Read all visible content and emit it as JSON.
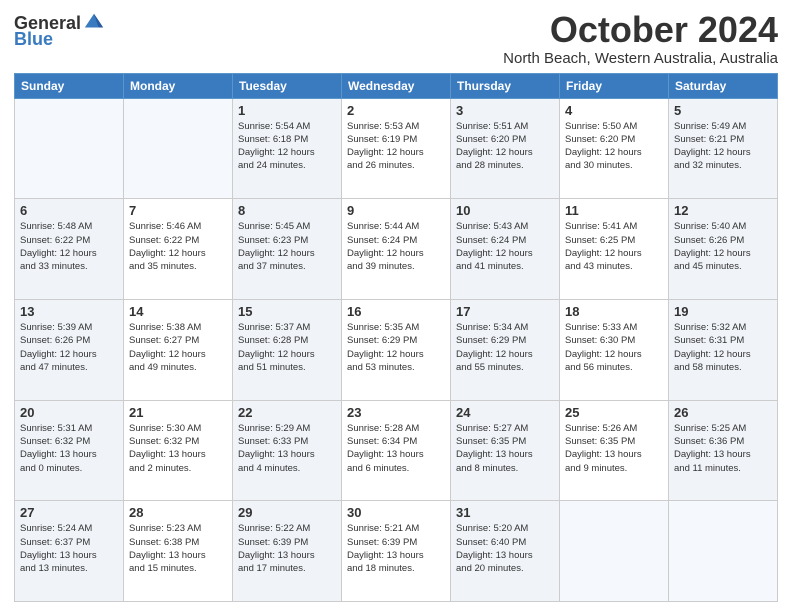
{
  "header": {
    "logo_general": "General",
    "logo_blue": "Blue",
    "month": "October 2024",
    "location": "North Beach, Western Australia, Australia"
  },
  "weekdays": [
    "Sunday",
    "Monday",
    "Tuesday",
    "Wednesday",
    "Thursday",
    "Friday",
    "Saturday"
  ],
  "rows": [
    [
      {
        "day": "",
        "content": ""
      },
      {
        "day": "",
        "content": ""
      },
      {
        "day": "1",
        "content": "Sunrise: 5:54 AM\nSunset: 6:18 PM\nDaylight: 12 hours\nand 24 minutes."
      },
      {
        "day": "2",
        "content": "Sunrise: 5:53 AM\nSunset: 6:19 PM\nDaylight: 12 hours\nand 26 minutes."
      },
      {
        "day": "3",
        "content": "Sunrise: 5:51 AM\nSunset: 6:20 PM\nDaylight: 12 hours\nand 28 minutes."
      },
      {
        "day": "4",
        "content": "Sunrise: 5:50 AM\nSunset: 6:20 PM\nDaylight: 12 hours\nand 30 minutes."
      },
      {
        "day": "5",
        "content": "Sunrise: 5:49 AM\nSunset: 6:21 PM\nDaylight: 12 hours\nand 32 minutes."
      }
    ],
    [
      {
        "day": "6",
        "content": "Sunrise: 5:48 AM\nSunset: 6:22 PM\nDaylight: 12 hours\nand 33 minutes."
      },
      {
        "day": "7",
        "content": "Sunrise: 5:46 AM\nSunset: 6:22 PM\nDaylight: 12 hours\nand 35 minutes."
      },
      {
        "day": "8",
        "content": "Sunrise: 5:45 AM\nSunset: 6:23 PM\nDaylight: 12 hours\nand 37 minutes."
      },
      {
        "day": "9",
        "content": "Sunrise: 5:44 AM\nSunset: 6:24 PM\nDaylight: 12 hours\nand 39 minutes."
      },
      {
        "day": "10",
        "content": "Sunrise: 5:43 AM\nSunset: 6:24 PM\nDaylight: 12 hours\nand 41 minutes."
      },
      {
        "day": "11",
        "content": "Sunrise: 5:41 AM\nSunset: 6:25 PM\nDaylight: 12 hours\nand 43 minutes."
      },
      {
        "day": "12",
        "content": "Sunrise: 5:40 AM\nSunset: 6:26 PM\nDaylight: 12 hours\nand 45 minutes."
      }
    ],
    [
      {
        "day": "13",
        "content": "Sunrise: 5:39 AM\nSunset: 6:26 PM\nDaylight: 12 hours\nand 47 minutes."
      },
      {
        "day": "14",
        "content": "Sunrise: 5:38 AM\nSunset: 6:27 PM\nDaylight: 12 hours\nand 49 minutes."
      },
      {
        "day": "15",
        "content": "Sunrise: 5:37 AM\nSunset: 6:28 PM\nDaylight: 12 hours\nand 51 minutes."
      },
      {
        "day": "16",
        "content": "Sunrise: 5:35 AM\nSunset: 6:29 PM\nDaylight: 12 hours\nand 53 minutes."
      },
      {
        "day": "17",
        "content": "Sunrise: 5:34 AM\nSunset: 6:29 PM\nDaylight: 12 hours\nand 55 minutes."
      },
      {
        "day": "18",
        "content": "Sunrise: 5:33 AM\nSunset: 6:30 PM\nDaylight: 12 hours\nand 56 minutes."
      },
      {
        "day": "19",
        "content": "Sunrise: 5:32 AM\nSunset: 6:31 PM\nDaylight: 12 hours\nand 58 minutes."
      }
    ],
    [
      {
        "day": "20",
        "content": "Sunrise: 5:31 AM\nSunset: 6:32 PM\nDaylight: 13 hours\nand 0 minutes."
      },
      {
        "day": "21",
        "content": "Sunrise: 5:30 AM\nSunset: 6:32 PM\nDaylight: 13 hours\nand 2 minutes."
      },
      {
        "day": "22",
        "content": "Sunrise: 5:29 AM\nSunset: 6:33 PM\nDaylight: 13 hours\nand 4 minutes."
      },
      {
        "day": "23",
        "content": "Sunrise: 5:28 AM\nSunset: 6:34 PM\nDaylight: 13 hours\nand 6 minutes."
      },
      {
        "day": "24",
        "content": "Sunrise: 5:27 AM\nSunset: 6:35 PM\nDaylight: 13 hours\nand 8 minutes."
      },
      {
        "day": "25",
        "content": "Sunrise: 5:26 AM\nSunset: 6:35 PM\nDaylight: 13 hours\nand 9 minutes."
      },
      {
        "day": "26",
        "content": "Sunrise: 5:25 AM\nSunset: 6:36 PM\nDaylight: 13 hours\nand 11 minutes."
      }
    ],
    [
      {
        "day": "27",
        "content": "Sunrise: 5:24 AM\nSunset: 6:37 PM\nDaylight: 13 hours\nand 13 minutes."
      },
      {
        "day": "28",
        "content": "Sunrise: 5:23 AM\nSunset: 6:38 PM\nDaylight: 13 hours\nand 15 minutes."
      },
      {
        "day": "29",
        "content": "Sunrise: 5:22 AM\nSunset: 6:39 PM\nDaylight: 13 hours\nand 17 minutes."
      },
      {
        "day": "30",
        "content": "Sunrise: 5:21 AM\nSunset: 6:39 PM\nDaylight: 13 hours\nand 18 minutes."
      },
      {
        "day": "31",
        "content": "Sunrise: 5:20 AM\nSunset: 6:40 PM\nDaylight: 13 hours\nand 20 minutes."
      },
      {
        "day": "",
        "content": ""
      },
      {
        "day": "",
        "content": ""
      }
    ]
  ]
}
